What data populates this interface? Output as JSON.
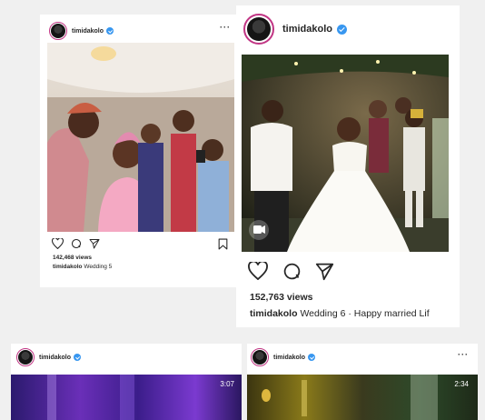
{
  "posts": [
    {
      "username": "timidakolo",
      "views": "142,468 views",
      "caption_user": "timidakolo",
      "caption_text": "Wedding 5"
    },
    {
      "username": "timidakolo",
      "views": "152,763 views",
      "caption_user": "timidakolo",
      "caption_text": "Wedding 6 · Happy married Lif"
    },
    {
      "username": "timidakolo",
      "duration": "3:07"
    },
    {
      "username": "timidakolo",
      "duration": "2:34"
    }
  ],
  "icons": {
    "like": "heart-icon",
    "comment": "comment-icon",
    "share": "share-icon",
    "save": "bookmark-icon",
    "video": "video-camera-icon",
    "verified": "verified-badge-icon",
    "more": "more-options-icon"
  }
}
